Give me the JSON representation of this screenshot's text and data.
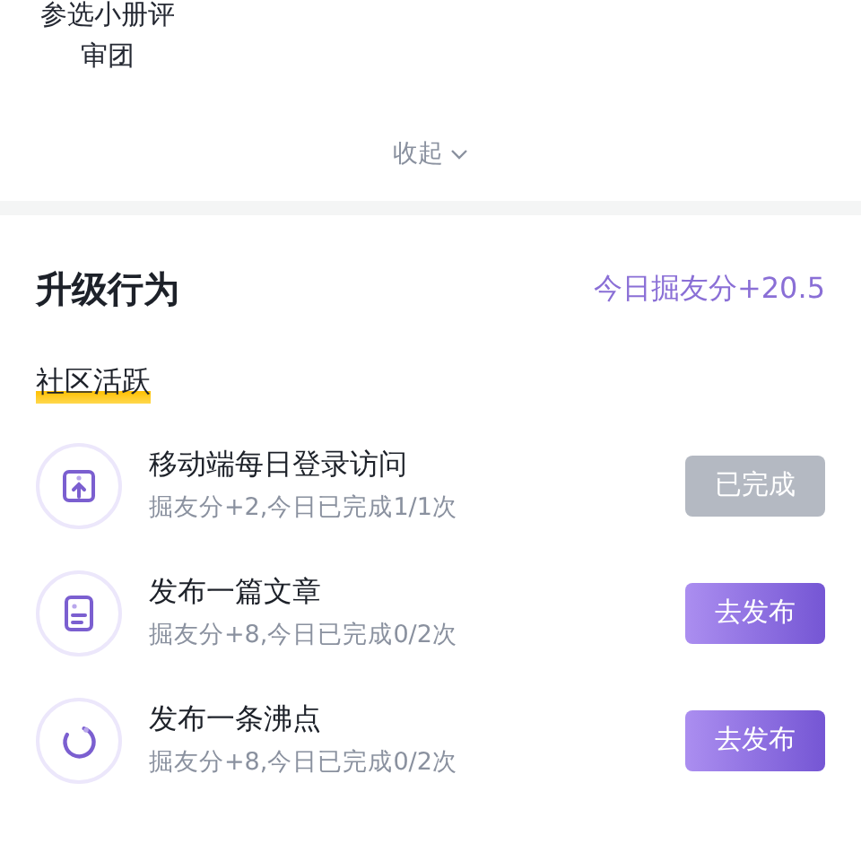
{
  "badge_label": "参选小册评审团",
  "collapse": {
    "label": "收起"
  },
  "section": {
    "title": "升级行为",
    "today_points": "今日掘友分+20.5"
  },
  "group": {
    "title": "社区活跃"
  },
  "tasks": [
    {
      "title": "移动端每日登录访问",
      "detail": "掘友分+2,今日已完成1/1次",
      "button": "已完成",
      "completed": true
    },
    {
      "title": "发布一篇文章",
      "detail": "掘友分+8,今日已完成0/2次",
      "button": "去发布",
      "completed": false
    },
    {
      "title": "发布一条沸点",
      "detail": "掘友分+8,今日已完成0/2次",
      "button": "去发布",
      "completed": false
    }
  ]
}
